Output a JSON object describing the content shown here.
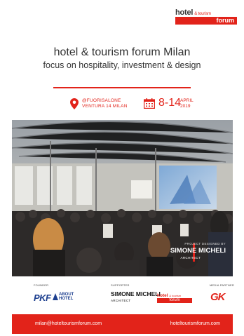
{
  "logo": {
    "line1": "hotel",
    "line1_small": "& tourism",
    "line2": "forum"
  },
  "header": {
    "title": "hotel & tourism forum Milan",
    "subtitle": "focus on hospitality, investment & design"
  },
  "event": {
    "location_line1": "@FUORISALONE",
    "location_line2": "VENTURA 14 MILAN",
    "dates": "8-14",
    "month": "APRIL",
    "year": "2019"
  },
  "photo": {
    "credit_label": "PROJECT DESIGNED BY",
    "credit_name": "SIMONE MICHELI",
    "credit_role": "ARCHITECT"
  },
  "sponsors": {
    "founder_label": "FOUNDER",
    "supporter_label": "SUPPORTER",
    "media_label": "MEDIA PARTNER",
    "pkf": "PKF",
    "about_1": "ABOUT",
    "about_2": "HOTEL",
    "simone_name": "SIMONE MICHELI",
    "simone_role": "ARCHITECT",
    "htf_1": "hotel",
    "htf_1_small": "& tourism",
    "htf_2": "forum",
    "gk": "GK"
  },
  "footer": {
    "email": "milan@hoteltourismforum.com",
    "website": "hoteltourismforum.com"
  },
  "colors": {
    "accent": "#e2231a",
    "text": "#333333"
  }
}
